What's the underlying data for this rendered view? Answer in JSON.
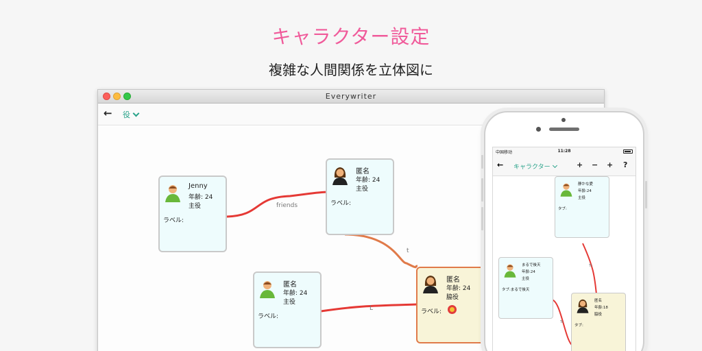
{
  "headline": {
    "title": "キャラクター設定",
    "subtitle": "複雑な人間関係を立体図に"
  },
  "desktop": {
    "window_title": "Everywriter",
    "toolbar": {
      "back_icon": "arrow-left-icon",
      "role_select": "役"
    },
    "cards": [
      {
        "name": "Jenny",
        "age": "年齢: 24",
        "role": "主役",
        "label": "ラベル:",
        "avatar": "green-person-icon"
      },
      {
        "name": "匿名",
        "age": "年齢: 24",
        "role": "主役",
        "label": "ラベル:",
        "avatar": "female-person-icon"
      },
      {
        "name": "匿名",
        "age": "年齢: 24",
        "role": "主役",
        "label": "ラベル:",
        "avatar": "green-person-icon"
      },
      {
        "name": "匿名",
        "age": "年齢: 24",
        "role": "脇役",
        "label": "ラベル:",
        "avatar": "female-person-icon",
        "selected": true
      }
    ],
    "edges": [
      {
        "label": "friends",
        "color": "#e53935"
      },
      {
        "label": "t",
        "color": "#e07a49"
      },
      {
        "label": "L",
        "color": "#e53935"
      }
    ]
  },
  "phone": {
    "status": {
      "carrier": "中国移动",
      "time": "11:28"
    },
    "toolbar": {
      "back_icon": "arrow-left-icon",
      "select": "キャラクター",
      "tools": [
        "+",
        "−",
        "+",
        "?"
      ]
    },
    "cards": [
      {
        "name": "静かな愛",
        "age": "年齢:24",
        "role": "主役",
        "label": "タブ:",
        "avatar": "green-person-icon"
      },
      {
        "name": "まるで後天",
        "age": "年齢:24",
        "role": "主役",
        "label": "タブ:まるで後天",
        "avatar": "green-person-icon"
      },
      {
        "name": "匿名",
        "age": "年齢:18",
        "role": "脇役",
        "label": "タブ:",
        "avatar": "female-person-icon",
        "selected": true
      }
    ],
    "edges": [
      {
        "label": "Tc",
        "color": "#e53935"
      },
      {
        "label": "Tc",
        "color": "#e53935"
      }
    ]
  }
}
